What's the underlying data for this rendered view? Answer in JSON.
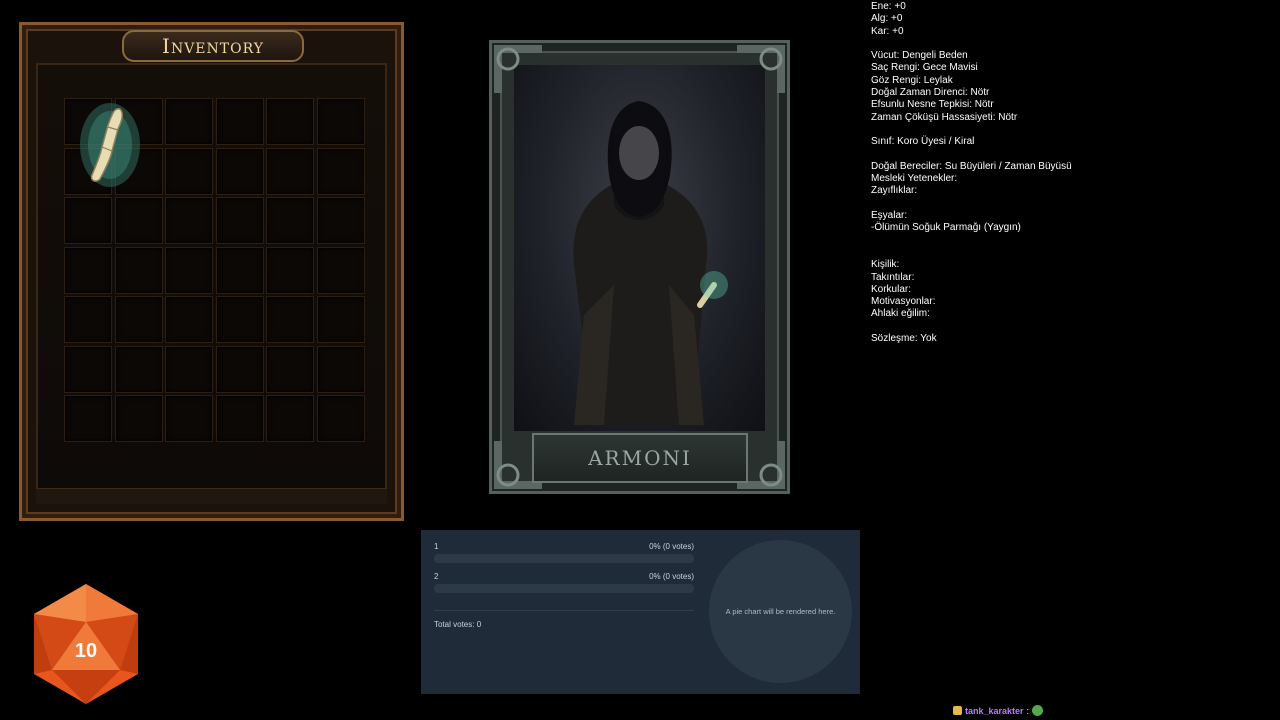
{
  "inventory": {
    "title": "Inventory",
    "rows": 7,
    "cols": 6,
    "item_icon": "bone-finger-icon"
  },
  "character_card": {
    "name": "ARMONI"
  },
  "stats": [
    "Ene: +0",
    "Alg: +0",
    "Kar: +0",
    "",
    "Vücut: Dengeli Beden",
    "Saç Rengi: Gece Mavisi",
    "Göz Rengi: Leylak",
    "Doğal Zaman Direnci: Nötr",
    "Efsunlu Nesne Tepkisi: Nötr",
    "Zaman Çöküşü Hassasiyeti: Nötr",
    "",
    "Sınıf: Koro Üyesi / Kiral",
    "",
    "Doğal Bereciler: Su Büyüleri / Zaman Büyüsü",
    "Mesleki Yetenekler:",
    "Zayıflıklar:",
    "",
    "Eşyalar:",
    "-Ölümün Soğuk Parmağı (Yaygın)",
    "",
    "",
    "Kişilik:",
    "Takıntılar:",
    "Korkular:",
    "Motivasyonlar:",
    "Ahlaki eğilim:",
    "",
    "Sözleşme: Yok"
  ],
  "poll": {
    "options": [
      {
        "label": "1",
        "result": "0% (0 votes)",
        "share": 0
      },
      {
        "label": "2",
        "result": "0% (0 votes)",
        "share": 0
      }
    ],
    "total": "Total votes: 0",
    "pie_placeholder": "A pie chart will be rendered here."
  },
  "dice": {
    "value": "10",
    "color": "#e8561e"
  },
  "chat": {
    "username": "tank_karakter",
    "separator": ":"
  }
}
